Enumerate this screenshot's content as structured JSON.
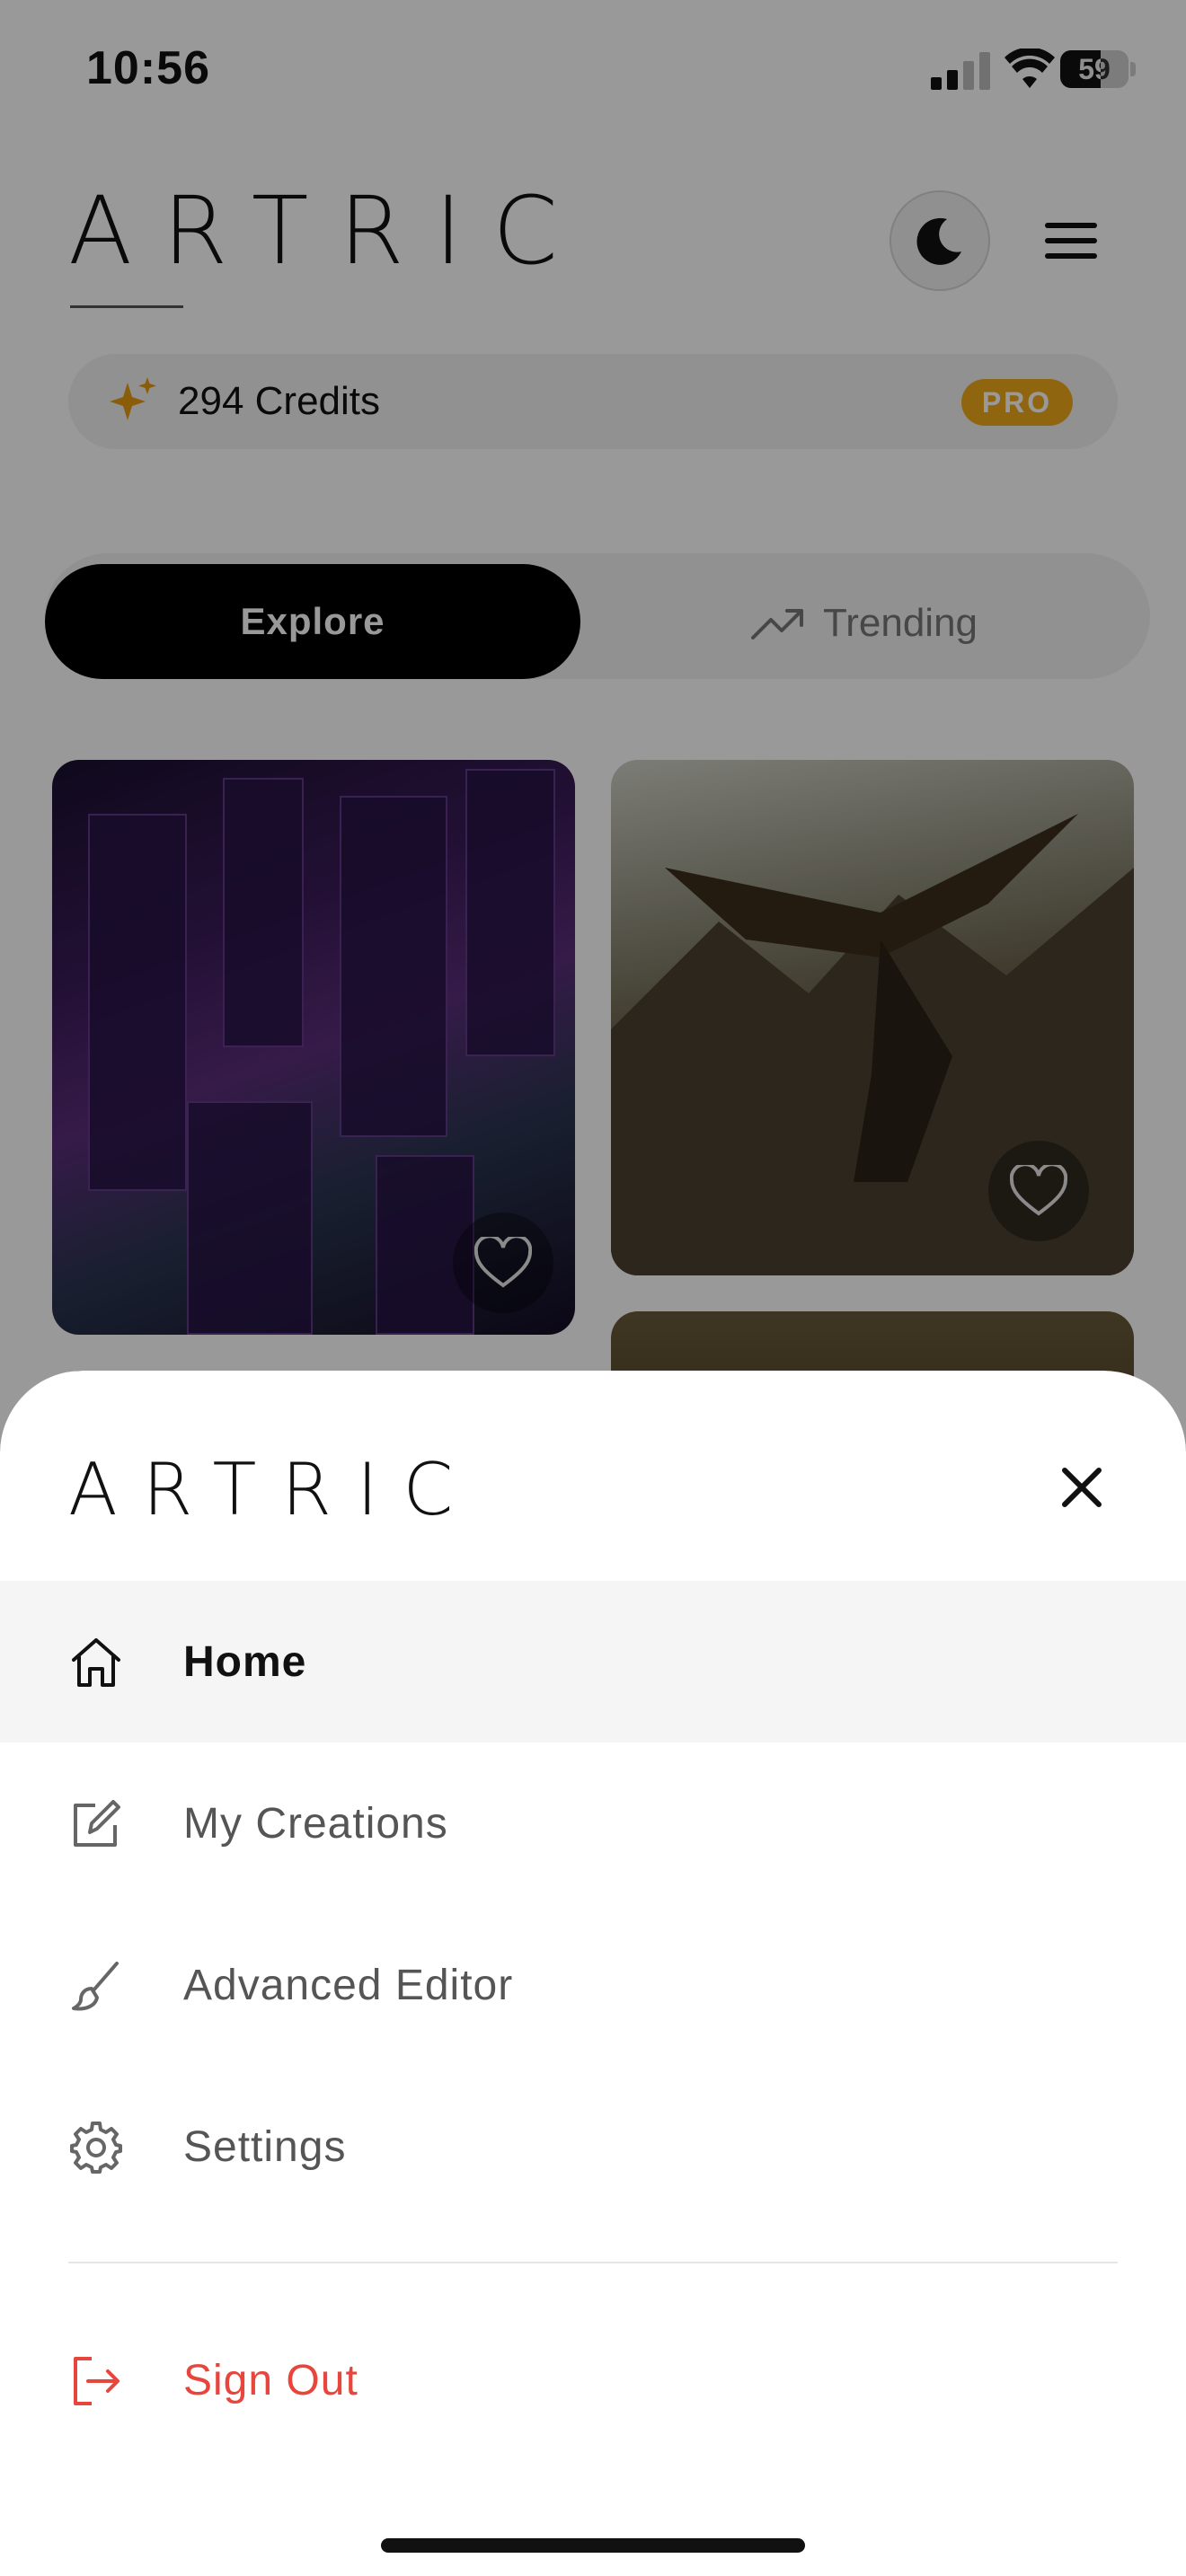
{
  "status_bar": {
    "time": "10:56",
    "battery": "59",
    "battery_level": 0.59
  },
  "header": {
    "brand": "ARTRIC",
    "theme_toggle_icon": "moon-icon",
    "menu_icon": "hamburger-menu-icon"
  },
  "credits": {
    "icon": "sparkles-icon",
    "label": "294 Credits",
    "badge": "PRO",
    "badge_color": "#f0a81c"
  },
  "tabs": [
    {
      "label": "Explore",
      "active": true
    },
    {
      "label": "Trending",
      "icon": "trending-up-icon",
      "active": false
    }
  ],
  "gallery": [
    {
      "subject": "cyberpunk-city",
      "liked": false
    },
    {
      "subject": "eagle-warrior",
      "liked": false
    }
  ],
  "sheet": {
    "brand": "ARTRIC",
    "close_icon": "close-icon",
    "items": [
      {
        "label": "Home",
        "icon": "home-icon",
        "active": true
      },
      {
        "label": "My Creations",
        "icon": "edit-icon",
        "active": false
      },
      {
        "label": "Advanced Editor",
        "icon": "brush-icon",
        "active": false
      },
      {
        "label": "Settings",
        "icon": "gear-icon",
        "active": false
      }
    ],
    "sign_out": {
      "label": "Sign Out",
      "icon": "sign-out-icon",
      "color": "#e8453c"
    }
  }
}
